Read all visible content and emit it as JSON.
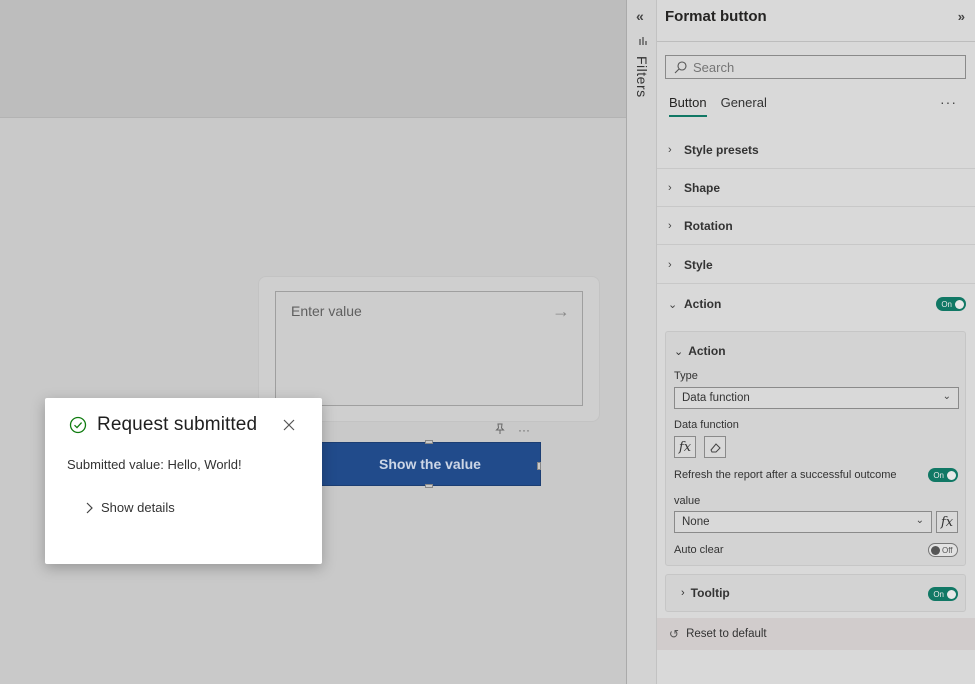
{
  "canvas": {
    "input_placeholder": "Enter value",
    "button_label": "Show the value",
    "visual_more": "···"
  },
  "toast": {
    "title": "Request submitted",
    "message": "Submitted value: Hello, World!",
    "details_label": "Show details"
  },
  "filters_rail": {
    "label": "Filters",
    "collapse": "«"
  },
  "pane": {
    "title": "Format button",
    "expand": "»",
    "search_placeholder": "Search",
    "tabs": [
      {
        "label": "Button",
        "active": true
      },
      {
        "label": "General",
        "active": false
      }
    ],
    "more": "···",
    "sections": [
      {
        "label": "Style presets"
      },
      {
        "label": "Shape"
      },
      {
        "label": "Rotation"
      },
      {
        "label": "Style"
      },
      {
        "label": "Action",
        "toggle": "On"
      }
    ],
    "action_card": {
      "title": "Action",
      "type_label": "Type",
      "type_value": "Data function",
      "data_function_label": "Data function",
      "refresh_label": "Refresh the report after a successful outcome",
      "refresh_toggle": "On",
      "value_label": "value",
      "value_value": "None",
      "auto_clear_label": "Auto clear",
      "auto_clear_toggle": "Off"
    },
    "tooltip": {
      "label": "Tooltip",
      "toggle": "On"
    },
    "reset_label": "Reset to default"
  },
  "colors": {
    "accent": "#117865",
    "button_fill": "#214b8b",
    "success": "#107c10"
  }
}
